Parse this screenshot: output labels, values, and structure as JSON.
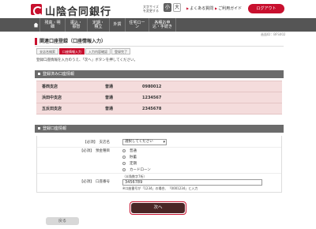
{
  "header": {
    "bank_name": "山陰合同銀行",
    "fontsize_label": "文字サイズを変更する",
    "fontsize_small": "小",
    "fontsize_large": "大",
    "faq_link": "よくある質問",
    "guide_link": "ご利用ガイド",
    "logout_label": "ログアウト"
  },
  "nav": {
    "items": [
      {
        "label": "残高・明細"
      },
      {
        "label": "振込・振替"
      },
      {
        "label": "定期・積立"
      },
      {
        "label": "外貨"
      },
      {
        "label": "住宅ローン"
      },
      {
        "label": "各種お申込・手続き"
      }
    ]
  },
  "page": {
    "screen_id": "画面ID：BFS002",
    "title": "関連口座登録（口座情報入力）",
    "steps": [
      "支店名検索",
      "口座情報入力",
      "入力内容確認",
      "登録完了"
    ],
    "active_step": 1,
    "intro": "登録口座情報を入力のうえ、「次へ」ボタンを押してください。"
  },
  "registered": {
    "heading": "登録済み口座情報",
    "rows": [
      {
        "branch": "香西支店",
        "type": "普通",
        "number": "0980012"
      },
      {
        "branch": "浜田中支店",
        "type": "普通",
        "number": "1234567"
      },
      {
        "branch": "五反田支店",
        "type": "普通",
        "number": "2345678"
      }
    ]
  },
  "form": {
    "heading": "登録口座情報",
    "branch_label": "【必須】　支店名",
    "branch_placeholder": "選択してください",
    "type_label": "【必須】　預金種目",
    "type_options": [
      "普通",
      "貯蓄",
      "定期",
      "カードローン"
    ],
    "account_label": "【必須】　口座番号",
    "account_hint": "（半角数字7桁）",
    "account_value": "3456789",
    "account_note": "※口座番号が「1234」の場合、「0001234」と入力"
  },
  "buttons": {
    "next_label": "次へ",
    "back_label": "戻る"
  }
}
